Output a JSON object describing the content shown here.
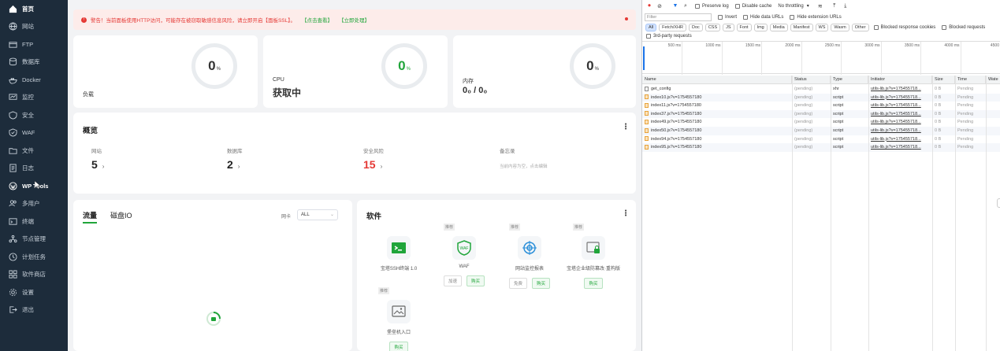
{
  "sidebar": {
    "items": [
      {
        "label": "首页",
        "icon": "home-icon",
        "active": true
      },
      {
        "label": "网站",
        "icon": "globe-icon"
      },
      {
        "label": "FTP",
        "icon": "ftp-icon"
      },
      {
        "label": "数据库",
        "icon": "database-icon"
      },
      {
        "label": "Docker",
        "icon": "docker-icon"
      },
      {
        "label": "监控",
        "icon": "monitor-icon"
      },
      {
        "label": "安全",
        "icon": "shield-icon"
      },
      {
        "label": "WAF",
        "icon": "waf-icon"
      },
      {
        "label": "文件",
        "icon": "folder-icon"
      },
      {
        "label": "日志",
        "icon": "log-icon"
      },
      {
        "label": "WP Tools",
        "icon": "wordpress-icon",
        "active": true
      },
      {
        "label": "多用户",
        "icon": "users-icon"
      },
      {
        "label": "终端",
        "icon": "terminal-icon"
      },
      {
        "label": "节点管理",
        "icon": "node-icon"
      },
      {
        "label": "计划任务",
        "icon": "clock-icon"
      },
      {
        "label": "软件商店",
        "icon": "grid-icon"
      },
      {
        "label": "设置",
        "icon": "gear-icon"
      },
      {
        "label": "退出",
        "icon": "logout-icon"
      }
    ]
  },
  "alert": {
    "text": "警告！当前面板使用HTTP访问，可能存在被窃取敏感信息风险，请立即开启【面板SSL】。",
    "link1": "【点击查看】",
    "link2": "【立即处理】"
  },
  "stats": {
    "load": {
      "label": "负载",
      "value": "0",
      "unit": "%"
    },
    "cpu": {
      "label": "CPU",
      "value": "0",
      "unit": "%",
      "status": "获取中"
    },
    "mem": {
      "label": "内存",
      "value": "0",
      "unit": "%",
      "status": "0₀ / 0₀"
    }
  },
  "overview": {
    "title": "概览",
    "items": [
      {
        "label": "网站",
        "value": "5"
      },
      {
        "label": "数据库",
        "value": "2"
      },
      {
        "label": "安全风险",
        "value": "15"
      },
      {
        "label": "备忘录",
        "hint": "当前内容为空，点击编辑"
      }
    ]
  },
  "traffic": {
    "tabs": [
      "流量",
      "磁盘IO"
    ],
    "select_label": "网卡",
    "select_value": "ALL"
  },
  "software": {
    "title": "软件",
    "items": [
      {
        "name": "宝塔SSH终端 1.0",
        "tag": "",
        "btns": []
      },
      {
        "name": "WAF",
        "tag": "推荐",
        "btns": [
          "加速",
          "购买"
        ]
      },
      {
        "name": "网站监控报表",
        "tag": "推荐",
        "btns": [
          "免费",
          "购买"
        ]
      },
      {
        "name": "宝塔企业级防篡改·重构版",
        "tag": "推荐",
        "btns": [
          "购买"
        ]
      },
      {
        "name": "堡垒机入口",
        "tag": "推荐",
        "btns": [
          "购买"
        ]
      }
    ]
  },
  "devtools": {
    "toolbar": {
      "preserve_log": "Preserve log",
      "disable_cache": "Disable cache",
      "throttle": "No throttling"
    },
    "filter_placeholder": "Filter",
    "invert": "Invert",
    "hide_data": "Hide data URLs",
    "hide_ext": "Hide extension URLs",
    "types": [
      "All",
      "Fetch/XHR",
      "Doc",
      "CSS",
      "JS",
      "Font",
      "Img",
      "Media",
      "Manifest",
      "WS",
      "Wasm",
      "Other"
    ],
    "blocked_cookies": "Blocked response cookies",
    "blocked_requests": "Blocked requests",
    "third_party": "3rd-party requests",
    "ticks": [
      "500 ms",
      "1000 ms",
      "1500 ms",
      "2000 ms",
      "2500 ms",
      "3000 ms",
      "3500 ms",
      "4000 ms",
      "4500"
    ],
    "columns": [
      "Name",
      "Status",
      "Type",
      "Initiator",
      "Size",
      "Time",
      "Wate"
    ],
    "rows": [
      {
        "name": "get_config",
        "status": "(pending)",
        "type": "xhr",
        "initiator": "utils-lib.js?v=175455718...",
        "size": "0 B",
        "time": "Pending",
        "kind": "doc"
      },
      {
        "name": "index10.js?v=1754557180",
        "status": "(pending)",
        "type": "script",
        "initiator": "utils-lib.js?v=175455718...",
        "size": "0 B",
        "time": "Pending",
        "kind": "script"
      },
      {
        "name": "index11.js?v=1754557180",
        "status": "(pending)",
        "type": "script",
        "initiator": "utils-lib.js?v=175455718...",
        "size": "0 B",
        "time": "Pending",
        "kind": "script"
      },
      {
        "name": "index37.js?v=1754557180",
        "status": "(pending)",
        "type": "script",
        "initiator": "utils-lib.js?v=175455718...",
        "size": "0 B",
        "time": "Pending",
        "kind": "script"
      },
      {
        "name": "index49.js?v=1754557180",
        "status": "(pending)",
        "type": "script",
        "initiator": "utils-lib.js?v=175455718...",
        "size": "0 B",
        "time": "Pending",
        "kind": "script"
      },
      {
        "name": "index50.js?v=1754557180",
        "status": "(pending)",
        "type": "script",
        "initiator": "utils-lib.js?v=175455718...",
        "size": "0 B",
        "time": "Pending",
        "kind": "script"
      },
      {
        "name": "index94.js?v=1754557180",
        "status": "(pending)",
        "type": "script",
        "initiator": "utils-lib.js?v=175455718...",
        "size": "0 B",
        "time": "Pending",
        "kind": "script"
      },
      {
        "name": "index95.js?v=1754557180",
        "status": "(pending)",
        "type": "script",
        "initiator": "utils-lib.js?v=175455718...",
        "size": "0 B",
        "time": "Pending",
        "kind": "script"
      }
    ]
  },
  "colors": {
    "accent": "#20a53a",
    "danger": "#e53935",
    "sidebar": "#1d2c3b"
  }
}
